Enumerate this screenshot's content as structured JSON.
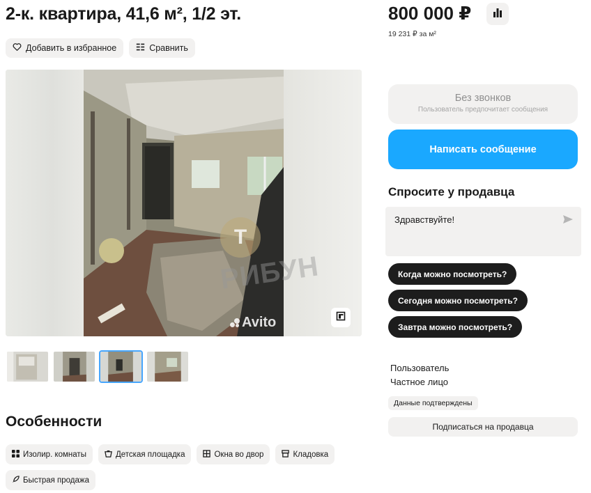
{
  "listing": {
    "title": "2-к. квартира, 41,6 м², 1/2 эт.",
    "actions": {
      "favorite_label": "Добавить в избранное",
      "compare_label": "Сравнить"
    }
  },
  "gallery": {
    "watermark_text": "РИБУН",
    "watermark_logo_letter": "Т",
    "avito_mark": "Avito",
    "thumbnails_count": 4,
    "active_thumbnail": 3
  },
  "features": {
    "title": "Особенности",
    "items": [
      {
        "label": "Изолир. комнаты",
        "icon": "grid-icon"
      },
      {
        "label": "Детская площадка",
        "icon": "playground-icon"
      },
      {
        "label": "Окна во двор",
        "icon": "window-icon"
      },
      {
        "label": "Кладовка",
        "icon": "storage-icon"
      },
      {
        "label": "Быстрая продажа",
        "icon": "rocket-icon"
      }
    ]
  },
  "price": {
    "amount": "800 000 ₽",
    "per_sqm": "19 231 ₽ за м²"
  },
  "contact": {
    "no_calls_title": "Без звонков",
    "no_calls_sub": "Пользователь предпочитает сообщения",
    "write_label": "Написать сообщение"
  },
  "ask": {
    "title": "Спросите у продавца",
    "message_value": "Здравствуйте!",
    "quick_questions": [
      "Когда можно посмотреть?",
      "Сегодня можно посмотреть?",
      "Завтра можно посмотреть?"
    ]
  },
  "seller": {
    "role": "Пользователь",
    "type": "Частное лицо",
    "verified_badge": "Данные подтверждены",
    "subscribe_label": "Подписаться на продавца"
  },
  "colors": {
    "accent_blue": "#1aa8ff",
    "chip_bg": "#f2f1f0",
    "dark_chip": "#1d1d1d",
    "active_thumb_border": "#47a6ff"
  }
}
